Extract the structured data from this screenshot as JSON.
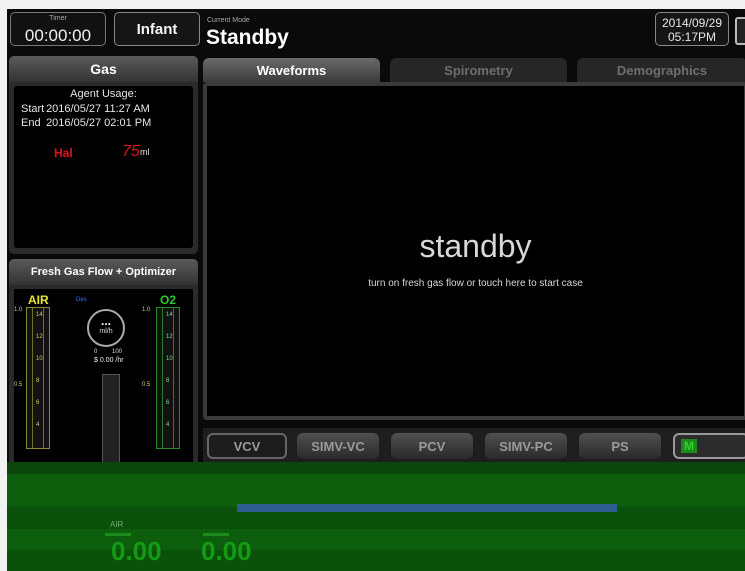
{
  "header": {
    "timer_label": "Timer",
    "timer_value": "00:00:00",
    "patient_type": "Infant",
    "mode_label": "Current Mode",
    "mode_value": "Standby",
    "date": "2014/09/29",
    "time": "05:17PM"
  },
  "gas_panel": {
    "title": "Gas",
    "agent_usage_title": "Agent Usage:",
    "start_label": "Start",
    "start_value": "2016/05/27 11:27 AM",
    "end_label": "End",
    "end_value": "2016/05/27 02:01 PM",
    "agent_name": "Hal",
    "agent_amount": "75",
    "agent_unit": "ml"
  },
  "fresh_gas_panel": {
    "title": "Fresh Gas Flow + Optimizer",
    "air_label": "AIR",
    "o2_label": "O2",
    "des_label": "Des",
    "gauge_value": "...",
    "gauge_unit": "ml/h",
    "gauge_min": "0",
    "gauge_max": "100",
    "cost": "$ 0.00 /hr",
    "scale_top": "1.0",
    "scale_mid": "0.5",
    "ticks": [
      "14",
      "12",
      "10",
      "8",
      "6",
      "4"
    ]
  },
  "tabs": [
    {
      "label": "Waveforms",
      "active": true
    },
    {
      "label": "Spirometry",
      "active": false
    },
    {
      "label": "Demographics",
      "active": false
    }
  ],
  "standby": {
    "title": "standby",
    "hint": "turn on fresh gas flow or touch here to start case"
  },
  "vent_modes": [
    {
      "label": "VCV",
      "state": "selected"
    },
    {
      "label": "SIMV-VC",
      "state": "normal"
    },
    {
      "label": "PCV",
      "state": "normal"
    },
    {
      "label": "SIMV-PC",
      "state": "normal"
    },
    {
      "label": "PS",
      "state": "normal"
    },
    {
      "label": "M",
      "state": "lit"
    }
  ],
  "bottom": {
    "air_label": "AIR",
    "value_1": "0.00",
    "value_2": "0.00"
  },
  "colors": {
    "screen_bg": "#0a0a0a",
    "alert_red": "#e0141a",
    "air_yellow": "#e8e830",
    "o2_green": "#2ec92e",
    "des_blue": "#3a6fff",
    "band_green": "#0c5e0c"
  }
}
